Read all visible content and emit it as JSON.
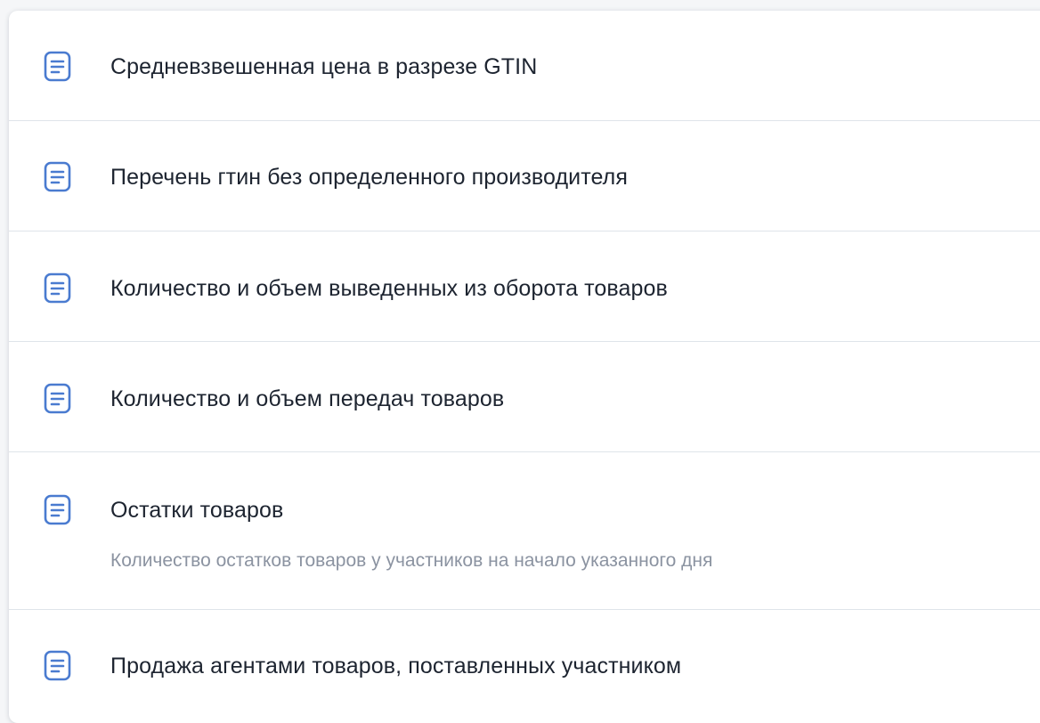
{
  "report_list": {
    "items": [
      {
        "title": "Средневзвешенная цена в разрезе GTIN",
        "icon": "document-icon"
      },
      {
        "title": "Перечень гтин без определенного производителя",
        "icon": "document-icon"
      },
      {
        "title": "Количество и объем выведенных из оборота товаров",
        "icon": "document-icon"
      },
      {
        "title": "Количество и объем передач товаров",
        "icon": "document-icon"
      },
      {
        "title": "Остатки товаров",
        "description": "Количество остатков товаров у участников на начало указанного дня",
        "icon": "document-icon"
      },
      {
        "title": "Продажа агентами товаров, поставленных участником",
        "icon": "document-icon"
      }
    ]
  },
  "colors": {
    "icon_accent": "#4a7bd0",
    "title_text": "#1d2430",
    "description_text": "#8b93a1",
    "divider": "#dfe4ea"
  }
}
